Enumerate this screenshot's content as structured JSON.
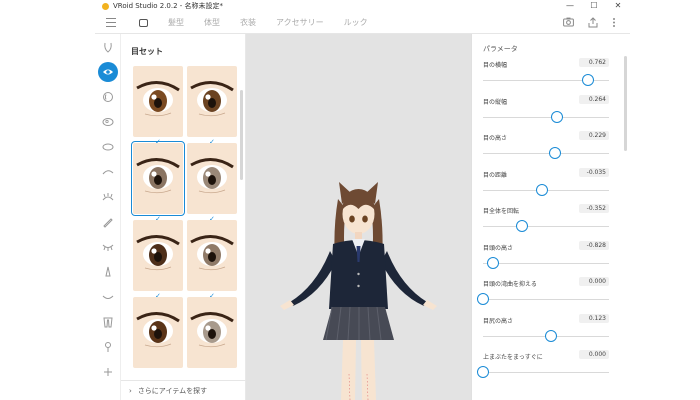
{
  "window": {
    "title": "VRoid Studio 2.0.2 - 名称未設定*",
    "controls": [
      "—",
      "☐",
      "✕"
    ]
  },
  "tabs": [
    {
      "label": "",
      "icon": "face-icon",
      "active": true
    },
    {
      "label": "髪型",
      "active": false
    },
    {
      "label": "体型",
      "active": false
    },
    {
      "label": "衣装",
      "active": false
    },
    {
      "label": "アクセサリー",
      "active": false
    },
    {
      "label": "ルック",
      "active": false
    }
  ],
  "top_actions": [
    "camera-icon",
    "share-icon",
    "more-vertical-icon"
  ],
  "category_icons": [
    "face-outline-icon",
    "eye-icon",
    "iris-icon",
    "eye-highlight-icon",
    "eye-white-icon",
    "eyeline-icon",
    "eyelash-icon",
    "eyebrow-pencil-icon",
    "lower-lash-icon",
    "nose-icon",
    "mouth-icon",
    "ear-icon",
    "cheek-icon",
    "accessory-icon"
  ],
  "list": {
    "title": "目セット",
    "more_items_label": "さらにアイテムを探す",
    "check_mark": "✓",
    "items": [
      {
        "iris": "#7a4a22",
        "selected": false,
        "checked": true
      },
      {
        "iris": "#6b4322",
        "selected": false,
        "checked": true
      },
      {
        "iris": "#8a7462",
        "selected": true,
        "checked": true
      },
      {
        "iris": "#9a8878",
        "selected": false,
        "checked": true
      },
      {
        "iris": "#4e2f1a",
        "selected": false,
        "checked": true
      },
      {
        "iris": "#8f7a68",
        "selected": false,
        "checked": true
      },
      {
        "iris": "#5a3418",
        "selected": false,
        "checked": false
      },
      {
        "iris": "#a89a8c",
        "selected": false,
        "checked": false
      }
    ]
  },
  "parameters": {
    "title": "パラメータ",
    "items": [
      {
        "label": "目の横幅",
        "value": "0.762",
        "fill": 0.83
      },
      {
        "label": "目の縦幅",
        "value": "0.264",
        "fill": 0.59
      },
      {
        "label": "目の高さ",
        "value": "0.229",
        "fill": 0.57
      },
      {
        "label": "目の距離",
        "value": "-0.035",
        "fill": 0.47
      },
      {
        "label": "目全体を回転",
        "value": "-0.352",
        "fill": 0.31
      },
      {
        "label": "目頭の高さ",
        "value": "-0.828",
        "fill": 0.08
      },
      {
        "label": "目頭の湾曲を抑える",
        "value": "0.000",
        "fill": 0.0
      },
      {
        "label": "目尻の高さ",
        "value": "0.123",
        "fill": 0.54
      },
      {
        "label": "上まぶたをまっすぐに",
        "value": "0.000",
        "fill": 0.0
      }
    ]
  },
  "colors": {
    "accent": "#1a8bd6",
    "viewport_bg": "#e3e3e3",
    "skin": "#f7e4d1",
    "hair": "#6e4a33",
    "blazer": "#1d2638",
    "skirt": "#474a55"
  }
}
